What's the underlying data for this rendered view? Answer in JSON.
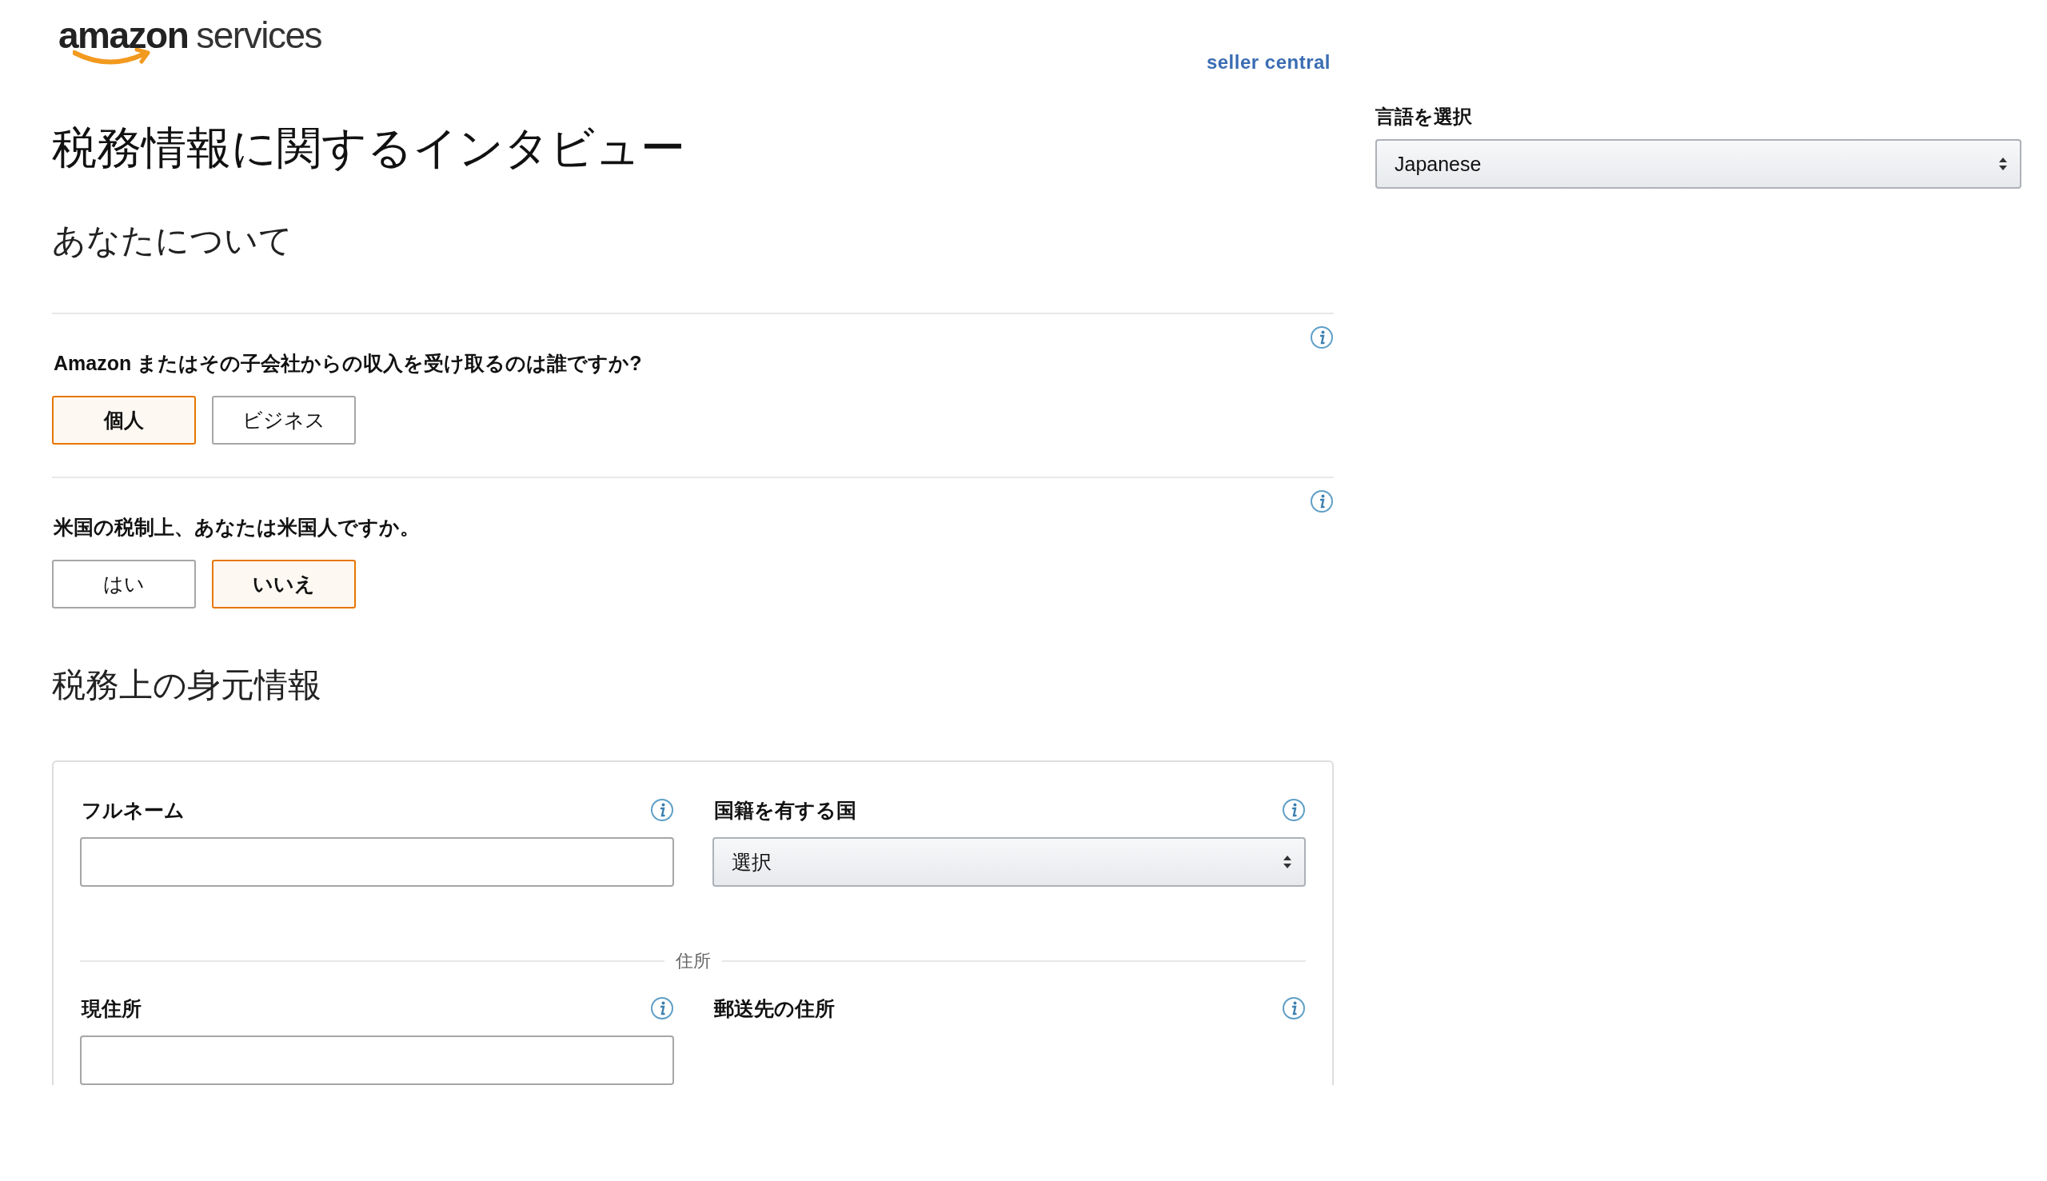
{
  "header": {
    "logo": {
      "brand": "amazon",
      "product": "services",
      "subtitle": "seller central"
    },
    "title": "税務情報に関するインタビュー"
  },
  "language": {
    "label": "言語を選択",
    "value": "Japanese"
  },
  "about_you": {
    "heading": "あなたについて",
    "questions": [
      {
        "text": "Amazon またはその子会社からの収入を受け取るのは誰ですか?",
        "options": [
          {
            "label": "個人",
            "selected": true
          },
          {
            "label": "ビジネス",
            "selected": false
          }
        ]
      },
      {
        "text": "米国の税制上、あなたは米国人ですか。",
        "options": [
          {
            "label": "はい",
            "selected": false
          },
          {
            "label": "いいえ",
            "selected": true
          }
        ]
      }
    ]
  },
  "tax_identity": {
    "heading": "税務上の身元情報",
    "fields": [
      {
        "label": "フルネーム",
        "kind": "text"
      },
      {
        "label": "国籍を有する国",
        "kind": "select",
        "value": "選択"
      }
    ],
    "divider_label": "住所",
    "address_fields": [
      {
        "label": "現住所",
        "kind": "text"
      },
      {
        "label": "郵送先の住所",
        "kind": "none"
      }
    ]
  }
}
